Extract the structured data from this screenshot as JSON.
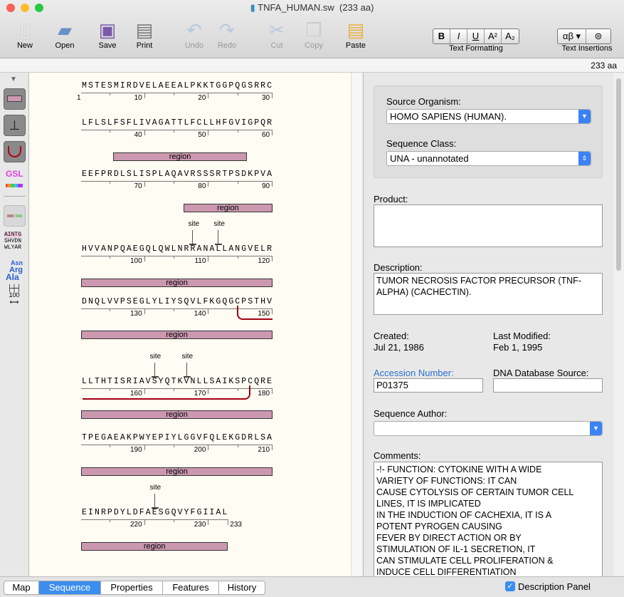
{
  "window": {
    "title": "TNFA_HUMAN.sw",
    "subtitle": "(233 aa)",
    "length_label": "233 aa"
  },
  "toolbar": {
    "new": "New",
    "open": "Open",
    "save": "Save",
    "print": "Print",
    "undo": "Undo",
    "redo": "Redo",
    "cut": "Cut",
    "copy": "Copy",
    "paste": "Paste",
    "text_formatting": "Text Formatting",
    "bold": "B",
    "italic": "I",
    "underline": "U",
    "superscript": "A²",
    "subscript": "A₂",
    "text_insertions": "Text Insertions",
    "greek": "αβ ▾",
    "link": "⊜"
  },
  "tools": {
    "gsl": "GSL",
    "aa_grid": [
      "AINTG",
      "SHVDN",
      "WLYAR"
    ],
    "aa_names": [
      "Asn",
      "Arg",
      "Ala"
    ],
    "scale": "100"
  },
  "sequence": {
    "feature_label": "region",
    "site_label": "site",
    "rows": [
      {
        "seq": "MSTESMIRDVELAEEALPKKTGGPQGSRRC",
        "start": 1,
        "labels": [
          "1",
          "10",
          "20",
          "30"
        ],
        "regions": [],
        "sites": [],
        "bracket": null
      },
      {
        "seq": "LFLSLFSFLIVAGATTLFCLLHFGVIGPQR",
        "start": 31,
        "labels": [
          "40",
          "50",
          "60"
        ],
        "regions": [
          [
            36,
            56
          ]
        ],
        "sites": [],
        "bracket": null
      },
      {
        "seq": "EEFPRDLSLISPLAQAVRSSSRTPSDKPVA",
        "start": 61,
        "labels": [
          "70",
          "80",
          "90"
        ],
        "regions": [
          [
            77,
            90
          ]
        ],
        "sites": [],
        "bracket": null
      },
      {
        "seq": "HVVANPQAEGQLQWLNRRANALLANGVELR",
        "start": 91,
        "labels": [
          "100",
          "110",
          "120"
        ],
        "regions": [
          [
            91,
            120
          ]
        ],
        "sites": [
          108,
          112
        ],
        "bracket": null
      },
      {
        "seq": "DNQLVVPSEGLYLIYSQVLFKGQGCPSTHV",
        "start": 121,
        "labels": [
          "130",
          "140",
          "150"
        ],
        "regions": [
          [
            121,
            150
          ]
        ],
        "sites": [],
        "bracket": [
          145,
          150
        ]
      },
      {
        "seq": "LLTHTISRIAVSYQTKVNLLSAIKSPCQRE",
        "start": 151,
        "labels": [
          "160",
          "170",
          "180"
        ],
        "regions": [
          [
            151,
            180
          ]
        ],
        "sites": [
          162,
          167
        ],
        "bracket": [
          151,
          177
        ]
      },
      {
        "seq": "TPEGAEAKPWYEPIYLGGVFQLEKGDRLSA",
        "start": 181,
        "labels": [
          "190",
          "200",
          "210"
        ],
        "regions": [
          [
            181,
            210
          ]
        ],
        "sites": [],
        "bracket": null
      },
      {
        "seq": "EINRPDYLDFAESGQVYFGIIAL",
        "start": 211,
        "labels": [
          "220",
          "230",
          "233"
        ],
        "regions": [
          [
            211,
            233
          ]
        ],
        "sites": [
          222
        ],
        "bracket": null
      }
    ]
  },
  "panel": {
    "source_organism_label": "Source Organism:",
    "source_organism": "HOMO SAPIENS (HUMAN).",
    "sequence_class_label": "Sequence Class:",
    "sequence_class": "UNA - unannotated",
    "product_label": "Product:",
    "product": "",
    "description_label": "Description:",
    "description": "TUMOR NECROSIS FACTOR PRECURSOR (TNF-ALPHA) (CACHECTIN).",
    "created_label": "Created:",
    "created": "Jul 21, 1986",
    "modified_label": "Last Modified:",
    "modified": "Feb 1, 1995",
    "accession_label": "Accession Number:",
    "accession": "P01375",
    "dna_label": "DNA Database Source:",
    "dna": "",
    "author_label": "Sequence Author:",
    "author": "",
    "comments_label": "Comments:",
    "comments": "-!- FUNCTION: CYTOKINE WITH A WIDE\nVARIETY OF FUNCTIONS: IT CAN\nCAUSE CYTOLYSIS OF CERTAIN TUMOR CELL\nLINES, IT IS IMPLICATED\nIN THE INDUCTION OF CACHEXIA, IT IS A\nPOTENT PYROGEN CAUSING\nFEVER BY DIRECT ACTION OR BY\nSTIMULATION OF IL-1 SECRETION, IT\nCAN STIMULATE CELL PROLIFERATION &\nINDUCE CELL DIFFERENTIATION"
  },
  "tabs": [
    {
      "label": "Map"
    },
    {
      "label": "Sequence",
      "active": true
    },
    {
      "label": "Properties"
    },
    {
      "label": "Features"
    },
    {
      "label": "History"
    }
  ],
  "description_panel": {
    "label": "Description Panel",
    "checked": true
  },
  "colors": {
    "accent": "#3b8df0",
    "region": "#cc98b0",
    "bracket": "#a00010",
    "link_label": "#2a6fd0"
  }
}
